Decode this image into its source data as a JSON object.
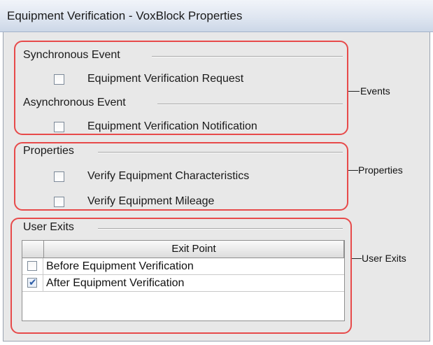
{
  "window": {
    "title": "Equipment Verification - VoxBlock Properties"
  },
  "events_group": {
    "synchronous_label": "Synchronous Event",
    "synchronous_checkbox_label": "Equipment Verification Request",
    "synchronous_checked": false,
    "asynchronous_label": "Asynchronous Event",
    "asynchronous_checkbox_label": "Equipment Verification Notification",
    "asynchronous_checked": false
  },
  "properties_group": {
    "label": "Properties",
    "items": [
      {
        "label": "Verify Equipment Characteristics",
        "checked": false
      },
      {
        "label": "Verify Equipment Mileage",
        "checked": false
      }
    ]
  },
  "user_exits_group": {
    "label": "User Exits",
    "table": {
      "column_header": "Exit Point",
      "rows": [
        {
          "label": "Before Equipment Verification",
          "checked": false
        },
        {
          "label": "After Equipment Verification",
          "checked": true
        }
      ]
    }
  },
  "callouts": {
    "events": "Events",
    "properties": "Properties",
    "user_exits": "User Exits"
  },
  "colors": {
    "annotation_outline": "#e74a4a",
    "title_bar": "#dfe6f1",
    "panel_background": "#e8e8e8"
  },
  "icons": {
    "checkmark": "check-icon"
  }
}
